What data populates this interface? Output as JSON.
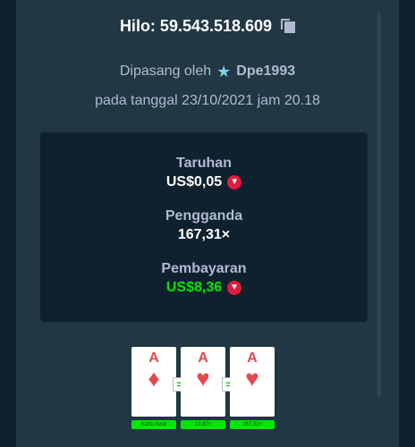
{
  "header": {
    "title": "Hilo: 59.543.518.609",
    "copy_icon": "copy-icon"
  },
  "placed_by": {
    "prefix": "Dipasang oleh",
    "icon": "star-icon",
    "username": "Dpe1993"
  },
  "date_line": "pada tanggal 23/10/2021 jam 20.18",
  "stats": {
    "bet": {
      "label": "Taruhan",
      "value": "US$0,05",
      "icon": "tron-coin-icon"
    },
    "multiplier": {
      "label": "Pengganda",
      "value": "167,31×"
    },
    "payout": {
      "label": "Pembayaran",
      "value": "US$8,36",
      "icon": "tron-coin-icon",
      "color": "#00e701"
    }
  },
  "cards": [
    {
      "rank": "A",
      "suit": "♦",
      "label": "Kartu Awal"
    },
    {
      "rank": "A",
      "suit": "♥",
      "label": "12,87×"
    },
    {
      "rank": "A",
      "suit": "♥",
      "label": "167,31×"
    }
  ],
  "equal_sign": "=",
  "colors": {
    "background": "#0f212e",
    "panel": "#213743",
    "muted_text": "#b1bad3",
    "accent_green": "#00e701",
    "card_red": "#e5484d",
    "coin_red": "#e5193d"
  }
}
